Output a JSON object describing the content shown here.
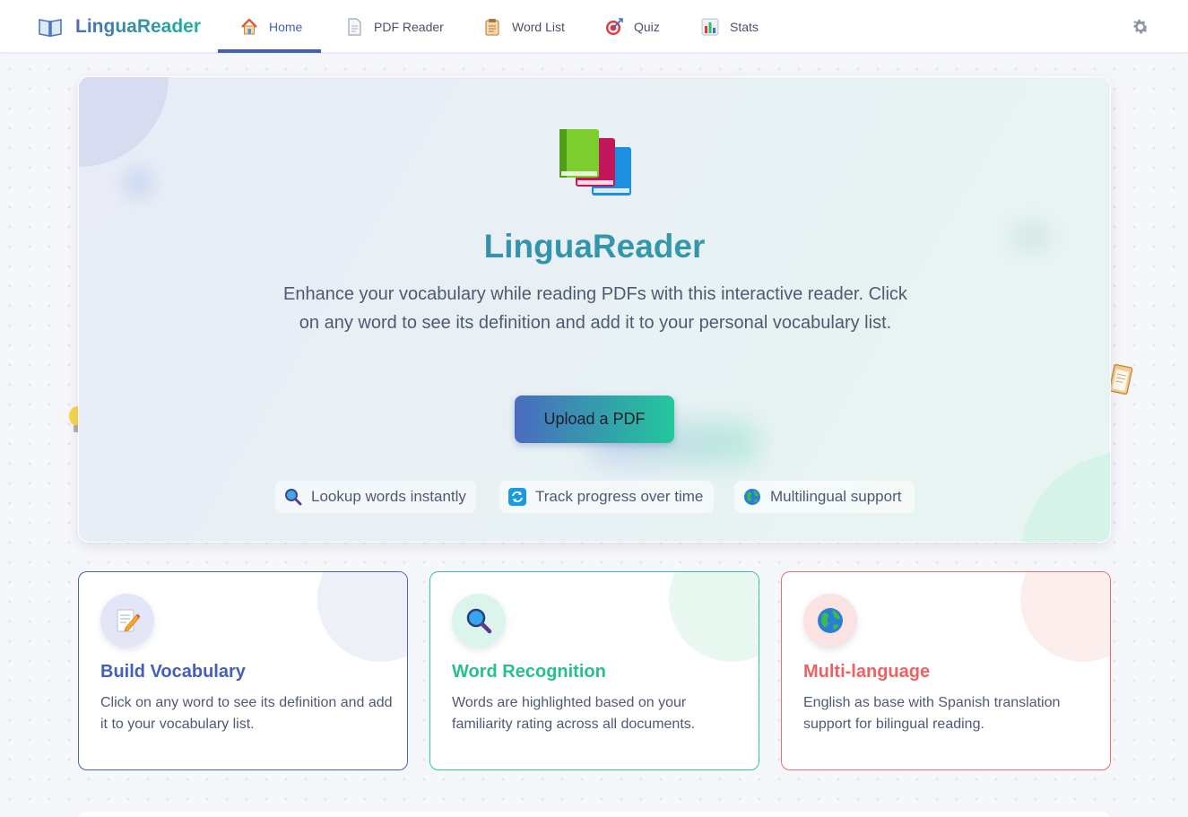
{
  "app": {
    "name": "LinguaReader",
    "brand_icon": "open-book-icon",
    "settings_icon": "gear-icon"
  },
  "nav": {
    "tabs": [
      {
        "label": "Home",
        "icon": "house-icon",
        "active": true
      },
      {
        "label": "PDF Reader",
        "icon": "document-icon",
        "active": false
      },
      {
        "label": "Word List",
        "icon": "clipboard-icon",
        "active": false
      },
      {
        "label": "Quiz",
        "icon": "target-icon",
        "active": false
      },
      {
        "label": "Stats",
        "icon": "bar-chart-icon",
        "active": false
      }
    ]
  },
  "hero": {
    "icon": "books-icon",
    "title": "LinguaReader",
    "description": "Enhance your vocabulary while reading PDFs with this interactive reader. Click on any word to see its definition and add it to your personal vocabulary list.",
    "upload_label": "Upload a PDF",
    "features": [
      {
        "label": "Lookup words instantly",
        "icon": "magnifier-icon"
      },
      {
        "label": "Track progress over time",
        "icon": "refresh-icon"
      },
      {
        "label": "Multilingual support",
        "icon": "globe-icon"
      }
    ]
  },
  "cards": [
    {
      "title": "Build Vocabulary",
      "text": "Click on any word to see its definition and add it to your vocabulary list.",
      "icon": "memo-pencil-icon",
      "color": "#4460b8"
    },
    {
      "title": "Word Recognition",
      "text": "Words are highlighted based on your familiarity rating across all documents.",
      "icon": "magnifier-icon",
      "color": "#26c08f"
    },
    {
      "title": "Multi-language",
      "text": "English as base with Spanish translation support for bilingual reading.",
      "icon": "globe-icon",
      "color": "#ef6262"
    }
  ]
}
